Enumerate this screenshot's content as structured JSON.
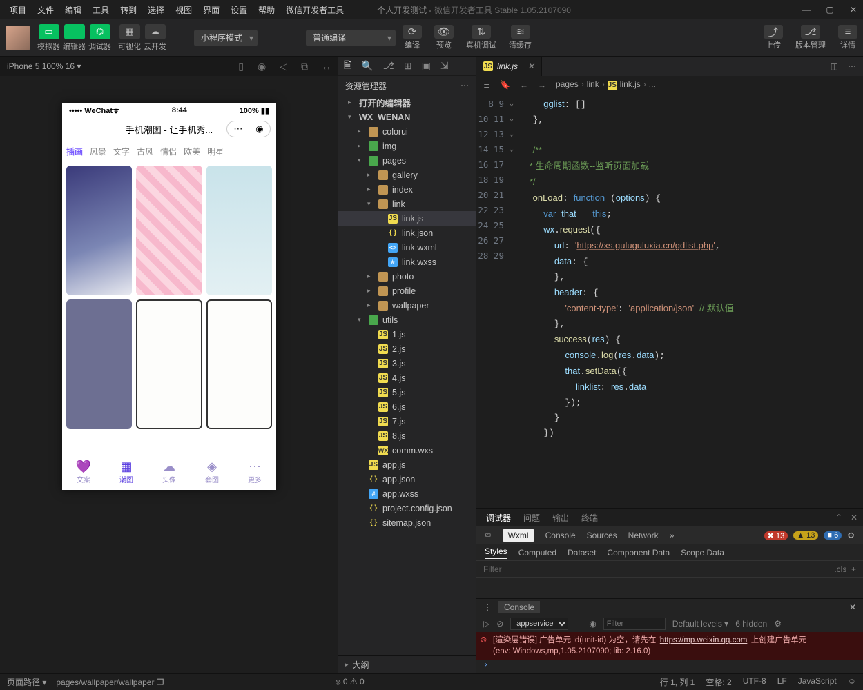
{
  "titlebar": {
    "menus": [
      "项目",
      "文件",
      "编辑",
      "工具",
      "转到",
      "选择",
      "视图",
      "界面",
      "设置",
      "帮助",
      "微信开发者工具"
    ],
    "project": "个人开发测试",
    "app_title": "微信开发者工具 Stable 1.05.2107090"
  },
  "toolbar": {
    "modes": [
      {
        "icon": "▭",
        "label": "模拟器"
      },
      {
        "icon": "</>",
        "label": "编辑器"
      },
      {
        "icon": "⌬",
        "label": "调试器"
      }
    ],
    "extra": [
      {
        "icon": "▦",
        "label": "可视化"
      },
      {
        "icon": "☁",
        "label": "云开发"
      }
    ],
    "compile_mode": "小程序模式",
    "compile_type": "普通编译",
    "center": [
      {
        "icon": "⟳",
        "label": "编译"
      },
      {
        "icon": "👁",
        "label": "预览"
      },
      {
        "icon": "⇅",
        "label": "真机调试"
      },
      {
        "icon": "≋",
        "label": "清缓存"
      }
    ],
    "right": [
      {
        "icon": "⤴",
        "label": "上传"
      },
      {
        "icon": "⎇",
        "label": "版本管理"
      },
      {
        "icon": "≡",
        "label": "详情"
      }
    ]
  },
  "simulator": {
    "device": "iPhone 5 100% 16",
    "icons": [
      "▯",
      "◉",
      "◁",
      "⧉",
      "↔"
    ]
  },
  "phone": {
    "carrier": "••••• WeChat",
    "wifi": "ᯤ",
    "time": "8:44",
    "battery": "100%",
    "title": "手机潮图 - 让手机秀...",
    "tabs": [
      "插画",
      "风景",
      "文字",
      "古风",
      "情侣",
      "欧美",
      "明星"
    ],
    "bottom": [
      {
        "icon": "💜",
        "label": "文案"
      },
      {
        "icon": "▦",
        "label": "潮图"
      },
      {
        "icon": "☁",
        "label": "头像"
      },
      {
        "icon": "◈",
        "label": "套图"
      },
      {
        "icon": "⋯",
        "label": "更多"
      }
    ]
  },
  "explorer": {
    "title": "资源管理器",
    "sections": {
      "open_editors": "打开的编辑器",
      "project": "WX_WENAN",
      "outline": "大纲"
    },
    "tree": [
      {
        "ind": 14,
        "arr": "▸",
        "fi": "",
        "name": "打开的编辑器",
        "bold": true
      },
      {
        "ind": 14,
        "arr": "▾",
        "fi": "",
        "name": "WX_WENAN",
        "bold": true
      },
      {
        "ind": 28,
        "arr": "▸",
        "fi": "fold",
        "name": "colorui"
      },
      {
        "ind": 28,
        "arr": "▸",
        "fi": "foldg",
        "name": "img"
      },
      {
        "ind": 28,
        "arr": "▾",
        "fi": "foldg",
        "name": "pages"
      },
      {
        "ind": 42,
        "arr": "▸",
        "fi": "fold",
        "name": "gallery"
      },
      {
        "ind": 42,
        "arr": "▸",
        "fi": "fold",
        "name": "index"
      },
      {
        "ind": 42,
        "arr": "▾",
        "fi": "fold",
        "name": "link"
      },
      {
        "ind": 56,
        "arr": "",
        "fi": "js",
        "name": "link.js",
        "sel": true
      },
      {
        "ind": 56,
        "arr": "",
        "fi": "jsonb",
        "name": "link.json"
      },
      {
        "ind": 56,
        "arr": "",
        "fi": "wxml",
        "name": "link.wxml"
      },
      {
        "ind": 56,
        "arr": "",
        "fi": "wxss",
        "name": "link.wxss"
      },
      {
        "ind": 42,
        "arr": "▸",
        "fi": "fold",
        "name": "photo"
      },
      {
        "ind": 42,
        "arr": "▸",
        "fi": "fold",
        "name": "profile"
      },
      {
        "ind": 42,
        "arr": "▸",
        "fi": "fold",
        "name": "wallpaper"
      },
      {
        "ind": 28,
        "arr": "▾",
        "fi": "foldg",
        "name": "utils"
      },
      {
        "ind": 42,
        "arr": "",
        "fi": "js",
        "name": "1.js"
      },
      {
        "ind": 42,
        "arr": "",
        "fi": "js",
        "name": "2.js"
      },
      {
        "ind": 42,
        "arr": "",
        "fi": "js",
        "name": "3.js"
      },
      {
        "ind": 42,
        "arr": "",
        "fi": "js",
        "name": "4.js"
      },
      {
        "ind": 42,
        "arr": "",
        "fi": "js",
        "name": "5.js"
      },
      {
        "ind": 42,
        "arr": "",
        "fi": "js",
        "name": "6.js"
      },
      {
        "ind": 42,
        "arr": "",
        "fi": "js",
        "name": "7.js"
      },
      {
        "ind": 42,
        "arr": "",
        "fi": "js",
        "name": "8.js"
      },
      {
        "ind": 42,
        "arr": "",
        "fi": "wxs",
        "name": "comm.wxs"
      },
      {
        "ind": 28,
        "arr": "",
        "fi": "js",
        "name": "app.js"
      },
      {
        "ind": 28,
        "arr": "",
        "fi": "jsonb",
        "name": "app.json"
      },
      {
        "ind": 28,
        "arr": "",
        "fi": "wxss",
        "name": "app.wxss"
      },
      {
        "ind": 28,
        "arr": "",
        "fi": "jsonb",
        "name": "project.config.json"
      },
      {
        "ind": 28,
        "arr": "",
        "fi": "jsonb",
        "name": "sitemap.json"
      }
    ]
  },
  "editor": {
    "tab": "link.js",
    "breadcrumb": [
      "pages",
      "link",
      "link.js",
      "..."
    ],
    "first_line_no": 8,
    "fold_markers": {
      "0": "",
      "1": "",
      "2": "",
      "3": "",
      "4": "⌄",
      "5": "",
      "6": "",
      "7": "",
      "8": "⌄",
      "9": "",
      "10": "",
      "11": "",
      "12": "",
      "13": "",
      "14": "⌄",
      "15": "",
      "16": "",
      "17": "",
      "18": "⌄",
      "19": "",
      "20": "",
      "21": "",
      "22": "",
      "23": ""
    },
    "lines": [
      "    <span class='c-prop'>gglist</span>: []",
      "  },",
      "",
      "  <span class='c-com'>/**</span>",
      "<span class='c-com'>   * 生命周期函数--监听页面加载</span>",
      "<span class='c-com'>   */</span>",
      "  <span class='c-fn'>onLoad</span>: <span class='c-key'>function</span> (<span class='c-var'>options</span>) {",
      "    <span class='c-key'>var</span> <span class='c-var'>that</span> = <span class='c-key'>this</span>;",
      "    <span class='c-var'>wx</span>.<span class='c-fn'>request</span>({",
      "      <span class='c-prop'>url</span>: <span class='c-str'>'<span class='c-url'>https://xs.guluguluxia.cn/gdlist.php</span>'</span>,",
      "      <span class='c-prop'>data</span>: {",
      "      },",
      "      <span class='c-prop'>header</span>: {",
      "        <span class='c-str'>'content-type'</span>: <span class='c-str'>'application/json'</span> <span class='c-com'>// 默认值</span>",
      "      },",
      "      <span class='c-fn'>success</span>(<span class='c-var'>res</span>) {",
      "        <span class='c-var'>console</span>.<span class='c-fn'>log</span>(<span class='c-var'>res</span>.<span class='c-var'>data</span>);",
      "        <span class='c-var'>that</span>.<span class='c-fn'>setData</span>({",
      "          <span class='c-prop'>linklist</span>: <span class='c-var'>res</span>.<span class='c-var'>data</span>",
      "        });",
      "      }",
      "    })"
    ]
  },
  "devtools": {
    "top_tabs": [
      "调试器",
      "问题",
      "输出",
      "终端"
    ],
    "sub_tabs": [
      "Wxml",
      "Console",
      "Sources",
      "Network"
    ],
    "badges": {
      "err": "13",
      "warn": "13",
      "info": "6"
    },
    "style_tabs": [
      "Styles",
      "Computed",
      "Dataset",
      "Component Data",
      "Scope Data"
    ],
    "filter_placeholder": "Filter",
    "cls": ".cls"
  },
  "console": {
    "label": "Console",
    "context": "appservice",
    "filter_placeholder": "Filter",
    "levels": "Default levels",
    "hidden": "6 hidden",
    "msg_pre": "[渲染层错误] 广告单元 id(unit-id) 为空，请先在 '",
    "msg_link": "https://mp.weixin.qq.com",
    "msg_post": "' 上创建广告单元",
    "msg_env": "(env: Windows,mp,1.05.2107090; lib: 2.16.0)"
  },
  "status": {
    "left_label": "页面路径",
    "path": "pages/wallpaper/wallpaper",
    "errwarn": "⦻ 0 ⚠ 0",
    "ln_col": "行 1, 列 1",
    "spaces": "空格: 2",
    "encoding": "UTF-8",
    "eol": "LF",
    "lang": "JavaScript"
  }
}
